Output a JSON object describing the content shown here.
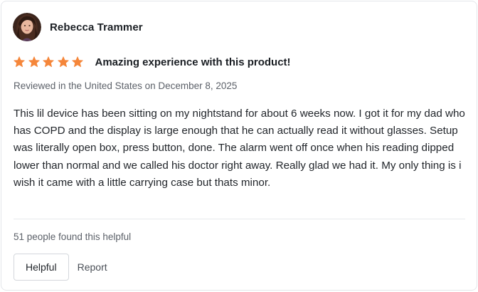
{
  "review": {
    "reviewer_name": "Rebecca Trammer",
    "avatar_icon": "user-photo-avatar",
    "rating": 5,
    "rating_max": 5,
    "star_color": "#f5863a",
    "title": "Amazing experience with this product!",
    "meta": "Reviewed in the United States on December 8, 2025",
    "body": "This lil device has been sitting on my nightstand for about 6 weeks now. I got it for my dad who has COPD and the display is large enough that he can actually read it without glasses. Setup was literally open box, press button, done. The alarm went off once when his reading dipped lower than normal and we called his doctor right away. Really glad we had it. My only thing is i wish it came with a little carrying case but thats minor.",
    "helpful_count_text": "51 people found this helpful",
    "helpful_label": "Helpful",
    "report_label": "Report"
  }
}
